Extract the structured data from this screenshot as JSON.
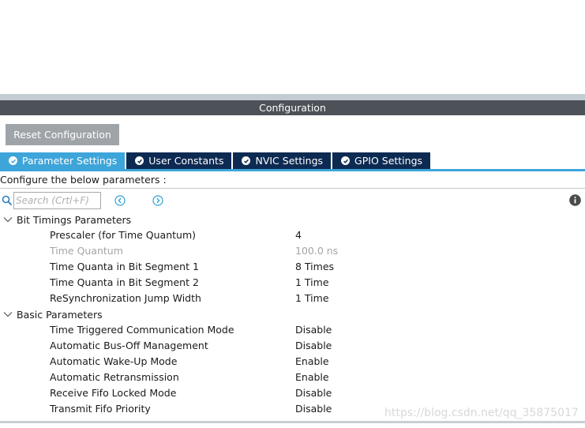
{
  "header": {
    "title": "Configuration"
  },
  "reset_button": {
    "label": "Reset Configuration"
  },
  "tabs": [
    {
      "label": "Parameter Settings",
      "active": true
    },
    {
      "label": "User Constants",
      "active": false
    },
    {
      "label": "NVIC Settings",
      "active": false
    },
    {
      "label": "GPIO Settings",
      "active": false
    }
  ],
  "subtitle": "Configure the below parameters :",
  "search": {
    "placeholder": "Search (Crtl+F)",
    "value": ""
  },
  "icons": {
    "search": "search-icon",
    "prev": "chevron-left-circle-icon",
    "next": "chevron-right-circle-icon",
    "info": "info-icon",
    "tab_status": "check-circle-icon"
  },
  "groups": [
    {
      "title": "Bit Timings Parameters",
      "rows": [
        {
          "label": "Prescaler (for Time Quantum)",
          "value": "4",
          "disabled": false
        },
        {
          "label": "Time Quantum",
          "value": "100.0 ns",
          "disabled": true
        },
        {
          "label": "Time Quanta in Bit Segment 1",
          "value": "8 Times",
          "disabled": false
        },
        {
          "label": "Time Quanta in Bit Segment 2",
          "value": "1 Time",
          "disabled": false
        },
        {
          "label": "ReSynchronization Jump Width",
          "value": "1 Time",
          "disabled": false
        }
      ]
    },
    {
      "title": "Basic Parameters",
      "rows": [
        {
          "label": "Time Triggered Communication Mode",
          "value": "Disable",
          "disabled": false
        },
        {
          "label": "Automatic Bus-Off Management",
          "value": "Disable",
          "disabled": false
        },
        {
          "label": "Automatic Wake-Up Mode",
          "value": "Enable",
          "disabled": false
        },
        {
          "label": "Automatic Retransmission",
          "value": "Enable",
          "disabled": false
        },
        {
          "label": "Receive Fifo Locked Mode",
          "value": "Disable",
          "disabled": false
        },
        {
          "label": "Transmit Fifo Priority",
          "value": "Disable",
          "disabled": false
        }
      ]
    }
  ],
  "watermark": "https://blog.csdn.net/qq_35875017",
  "colors": {
    "tab_active": "#3da5d9",
    "tab_inactive": "#0d2a52",
    "header_bg": "#4d5258",
    "button_bg": "#9fa4a9",
    "disabled_text": "#a5a5a5"
  }
}
